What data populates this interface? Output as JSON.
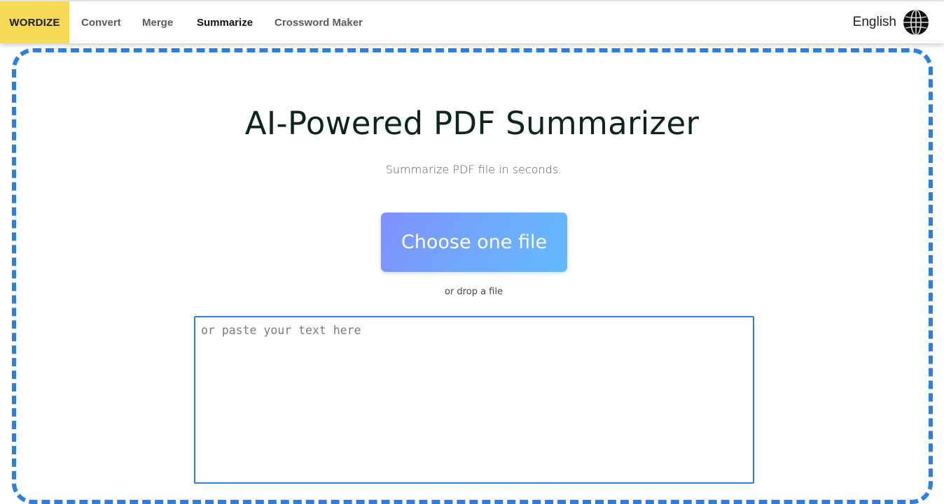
{
  "navbar": {
    "brand": "WORDIZE",
    "items": [
      {
        "label": "Convert",
        "active": false
      },
      {
        "label": "Merge",
        "active": false
      },
      {
        "label": "Summarize",
        "active": true
      },
      {
        "label": "Crossword Maker",
        "active": false
      }
    ],
    "language": {
      "label": "English",
      "icon": "globe-icon"
    }
  },
  "main": {
    "title": "AI-Powered PDF Summarizer",
    "subtitle": "Summarize PDF file in seconds.",
    "choose_button": "Choose one file",
    "drop_hint": "or drop a file",
    "paste_area": {
      "value": "",
      "placeholder": "or paste your text here"
    }
  },
  "colors": {
    "brand_bg": "#f6d955",
    "dropzone_border": "#2b7fe2",
    "button_gradient_start": "#8090fd",
    "button_gradient_end": "#63baff"
  }
}
